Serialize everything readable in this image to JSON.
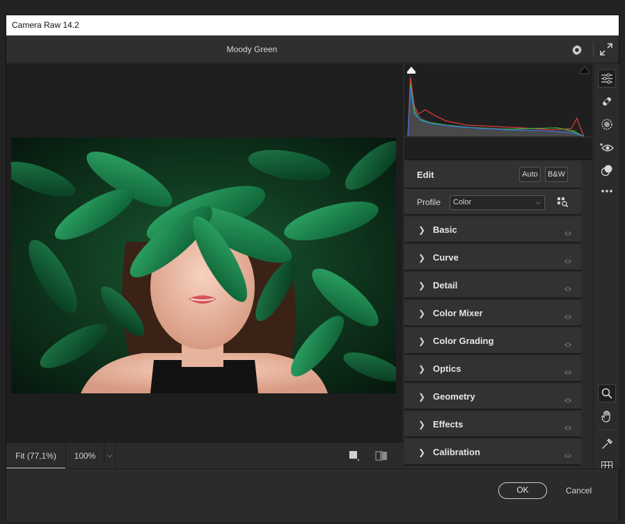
{
  "window": {
    "title": "Camera Raw 14.2"
  },
  "header": {
    "document_title": "Moody Green",
    "settings_icon": "gear-icon",
    "expand_icon": "fullscreen-icon"
  },
  "image": {
    "subject": "woman-with-green-leaves-photo"
  },
  "bottom_bar": {
    "zoom_fit_label": "Fit (77,1%)",
    "zoom_100_label": "100%"
  },
  "edit_panel": {
    "heading": "Edit",
    "auto_label": "Auto",
    "bw_label": "B&W",
    "profile_label": "Profile",
    "profile_value": "Color",
    "sections": [
      "Basic",
      "Curve",
      "Detail",
      "Color Mixer",
      "Color Grading",
      "Optics",
      "Geometry",
      "Effects",
      "Calibration"
    ]
  },
  "right_toolbar": {
    "top_tools": [
      "edit-sliders-icon",
      "healing-bandage-icon",
      "masking-icon",
      "red-eye-icon",
      "presets-icon",
      "more-icon"
    ],
    "bottom_tools": [
      "zoom-icon",
      "hand-icon",
      "color-sampler-icon",
      "grid-icon"
    ]
  },
  "footer": {
    "ok_label": "OK",
    "cancel_label": "Cancel"
  },
  "colors": {
    "background": "#2b2b2b",
    "canvas": "#1e1e1e",
    "panel_row": "#323232",
    "text": "#d6d6d6",
    "hist_red": "#e03a3a",
    "hist_green": "#3ab83a",
    "hist_blue": "#3a6ae0"
  }
}
